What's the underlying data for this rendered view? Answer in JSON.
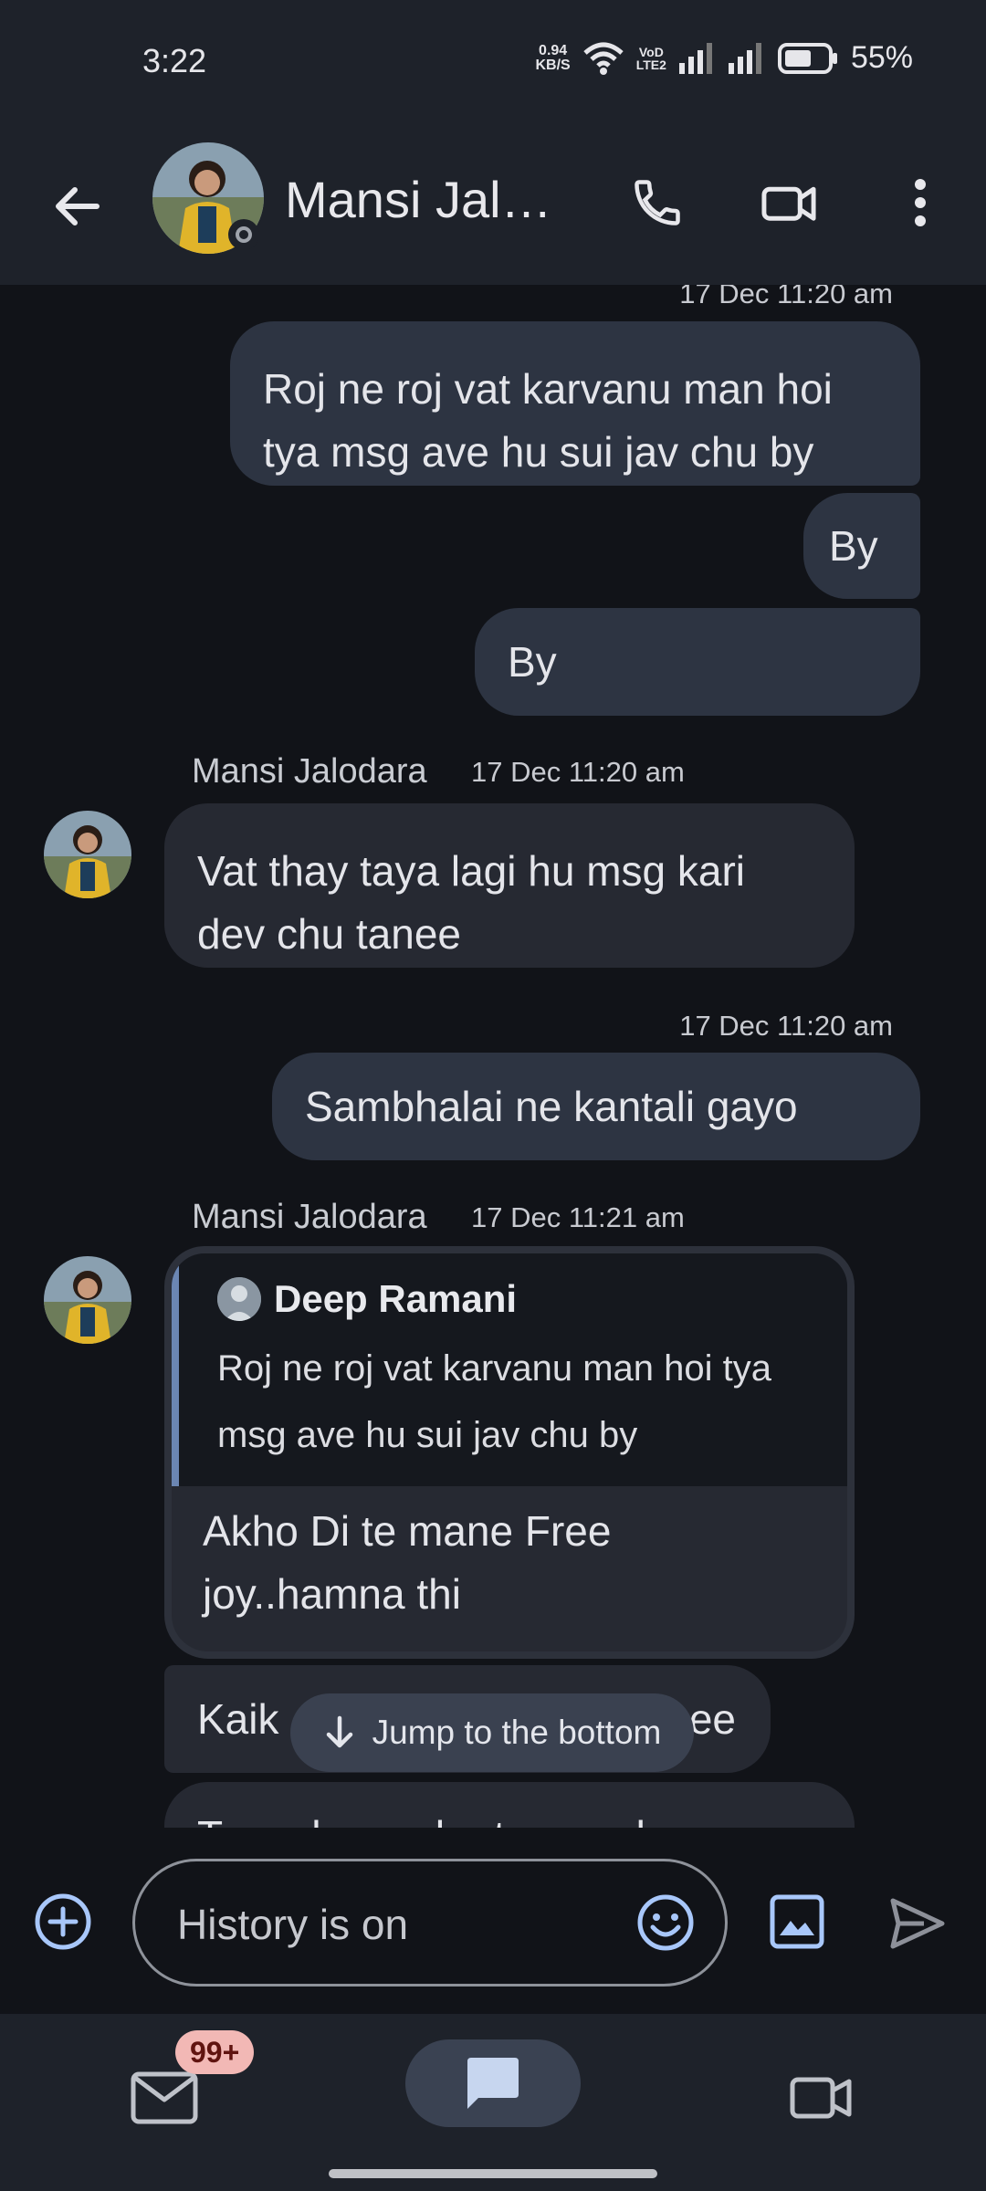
{
  "status_bar": {
    "time": "3:22",
    "net_speed_value": "0.94",
    "net_speed_unit": "KB/S",
    "volte_top": "VoD",
    "volte_bottom": "LTE2",
    "battery": "55%"
  },
  "header": {
    "contact_name": "Mansi Jalodara"
  },
  "messages": {
    "m1_time": "17 Dec 11:20 am",
    "m1_text": "Roj ne roj vat karvanu man hoi tya msg ave hu sui jav chu by",
    "m2_text": "By",
    "m3_text": "By",
    "m4_sender": "Mansi Jalodara",
    "m4_time": "17 Dec 11:20 am",
    "m4_text": "Vat thay taya lagi hu msg kari dev chu tanee",
    "m5_time": "17 Dec 11:20 am",
    "m5_text": "Sambhalai ne kantali gayo",
    "m6_sender": "Mansi Jalodara",
    "m6_time": "17 Dec 11:21 am",
    "quote_author": "Deep Ramani",
    "quote_text": "Roj ne roj vat karvanu man hoi tya msg ave hu sui jav chu by",
    "m6_text": "Akho Di te mane Free joy..hamna thi",
    "m7_text_start": "Kaik",
    "m7_text_end": "ee",
    "m8_text_partial": "Tame hovo cho tamare kam na"
  },
  "jump": {
    "label": "Jump to the bottom"
  },
  "composer": {
    "placeholder": "History is on"
  },
  "nav": {
    "mail_badge": "99+"
  },
  "icons": {
    "back": "arrow-left",
    "phone": "phone",
    "video": "video-camera",
    "more": "more-vertical",
    "add": "plus-circle",
    "emoji": "smiley",
    "image": "image",
    "send": "send",
    "mail": "mail",
    "chat": "chat-bubble",
    "meet": "video-camera"
  },
  "colors": {
    "background": "#111318",
    "header": "#1e222a",
    "outgoing_bubble": "#2d3442",
    "incoming_bubble": "#262932",
    "accent": "#a8c7fa",
    "badge": "#f2b8b5"
  }
}
